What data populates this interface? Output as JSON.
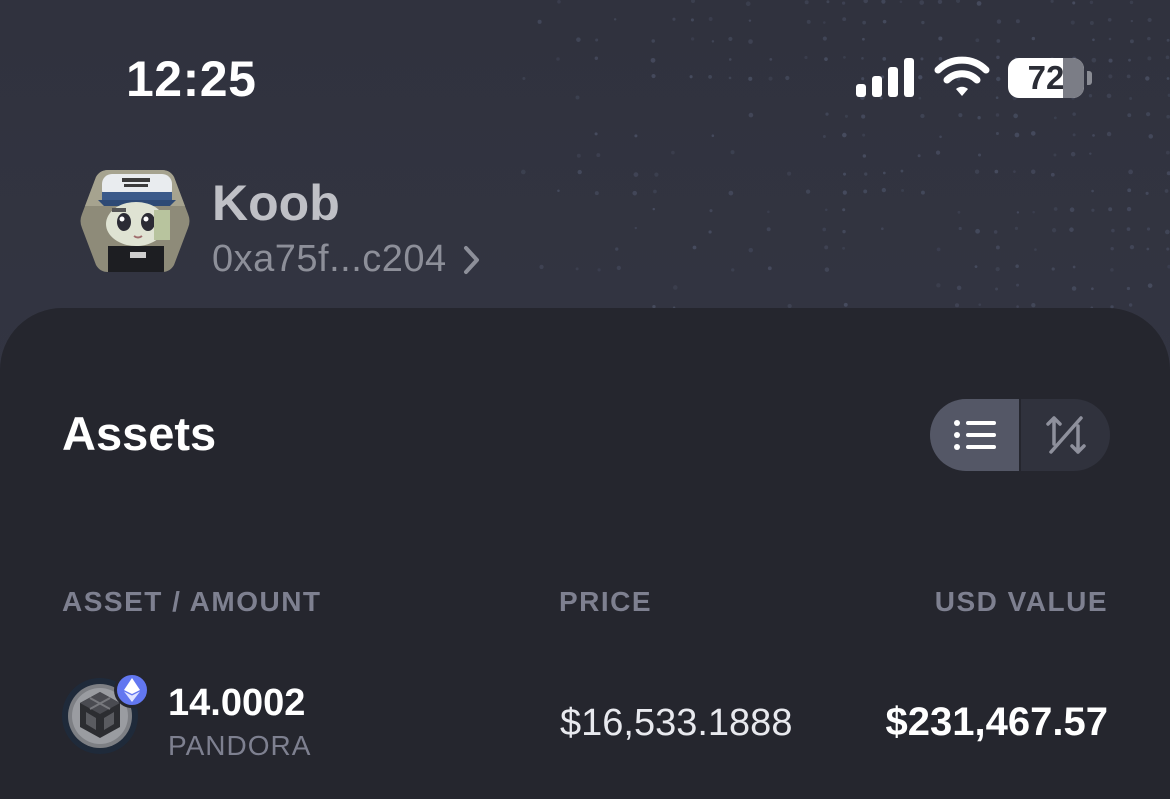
{
  "status_bar": {
    "time": "12:25",
    "battery_level": "72",
    "battery_fraction": 0.72
  },
  "profile": {
    "name": "Koob",
    "wallet_address": "0xa75f...c204"
  },
  "assets": {
    "title": "Assets",
    "columns": {
      "asset_amount": "ASSET / AMOUNT",
      "price": "PRICE",
      "usd_value": "USD VALUE"
    },
    "rows": [
      {
        "amount": "14.0002",
        "symbol": "PANDORA",
        "price": "$16,533.1888",
        "usd_value": "$231,467.57",
        "chain_icon": "ethereum-icon"
      }
    ]
  },
  "colors": {
    "header_bg": "#30323e",
    "panel_bg": "#25262e",
    "accent_badge": "#6277f0",
    "muted_text": "#7e8090"
  }
}
